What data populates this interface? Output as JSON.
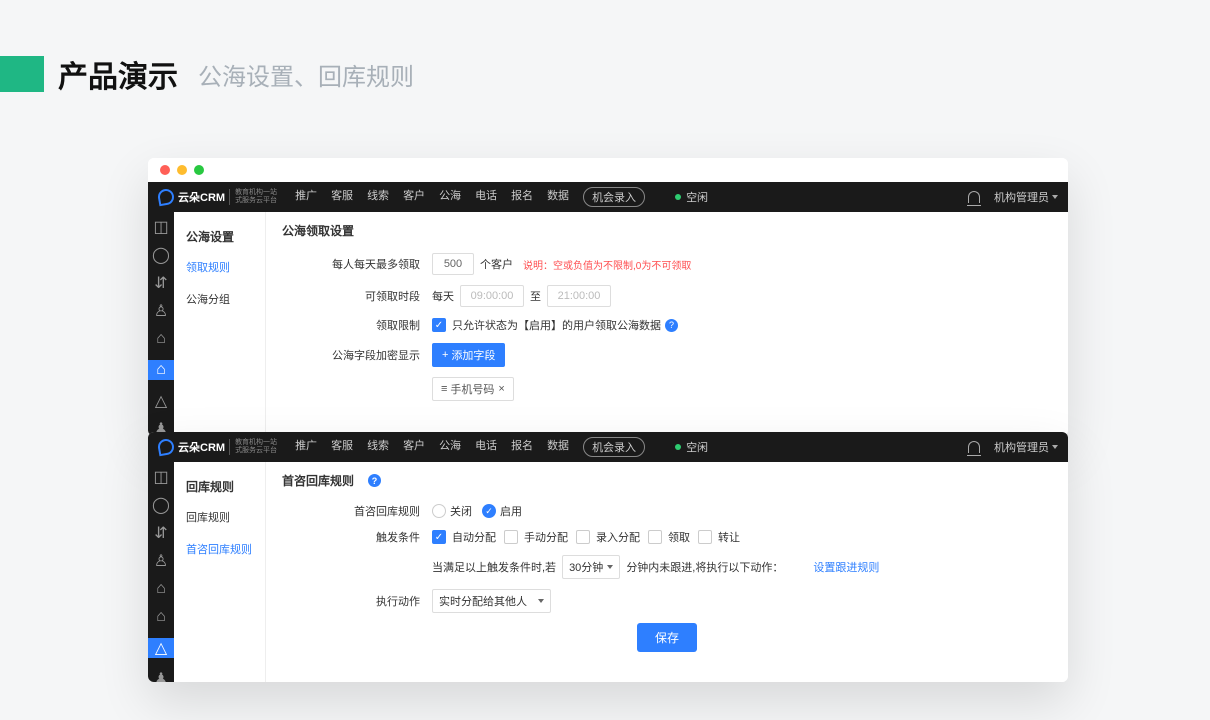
{
  "slide": {
    "title": "产品演示",
    "subtitle": "公海设置、回库规则"
  },
  "logo": {
    "brand": "云朵CRM",
    "tag1": "教育机构一站",
    "tag2": "式服务云平台"
  },
  "nav": [
    "推广",
    "客服",
    "线索",
    "客户",
    "公海",
    "电话",
    "报名",
    "数据"
  ],
  "nav_pill": "机会录入",
  "status": "空闲",
  "user": "机构管理员",
  "win1": {
    "side_title": "公海设置",
    "side_items": [
      "领取规则",
      "公海分组"
    ],
    "side_active": 0,
    "content_title": "公海领取设置",
    "row1_label": "每人每天最多领取",
    "row1_value": "500",
    "row1_suffix": "个客户",
    "row1_hint_pre": "说明：",
    "row1_hint": "空或负值为不限制,0为不可领取",
    "row2_label": "可领取时段",
    "row2_prefix": "每天",
    "row2_t1": "09:00:00",
    "row2_mid": "至",
    "row2_t2": "21:00:00",
    "row3_label": "领取限制",
    "row3_text": "只允许状态为【启用】的用户领取公海数据",
    "row4_label": "公海字段加密显示",
    "row4_btn": "添加字段",
    "row4_tag": "手机号码"
  },
  "win2": {
    "side_title": "回库规则",
    "side_items": [
      "回库规则",
      "首咨回库规则"
    ],
    "side_active": 1,
    "content_title": "首咨回库规则",
    "row1_label": "首咨回库规则",
    "row1_opt_off": "关闭",
    "row1_opt_on": "启用",
    "row2_label": "触发条件",
    "row2_opts": [
      "自动分配",
      "手动分配",
      "录入分配",
      "领取",
      "转让"
    ],
    "row2_checked": [
      true,
      false,
      false,
      false,
      false
    ],
    "row3_pre": "当满足以上触发条件时,若",
    "row3_select": "30分钟",
    "row3_post": "分钟内未跟进,将执行以下动作：",
    "row3_link": "设置跟进规则",
    "row4_label": "执行动作",
    "row4_select": "实时分配给其他人",
    "save": "保存"
  }
}
